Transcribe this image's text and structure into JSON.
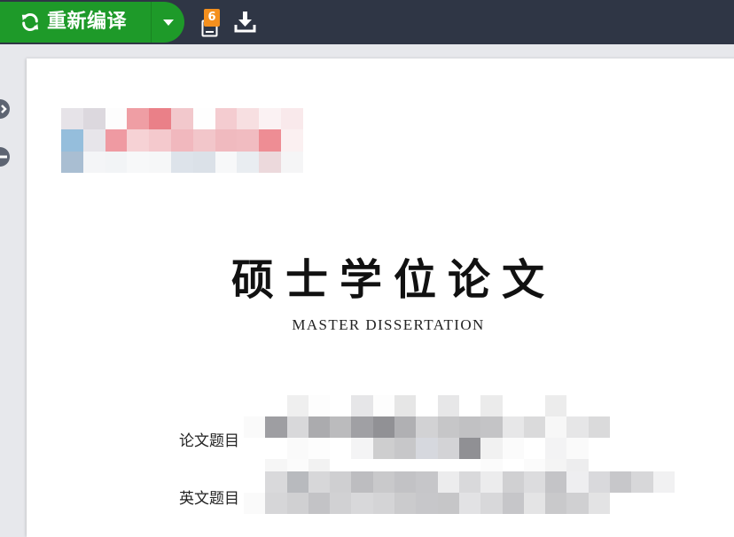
{
  "toolbar": {
    "recompile_label": "重新编译",
    "logs_badge_count": "6",
    "colors": {
      "bar": "#2f3645",
      "recompile": "#1e9a29",
      "badge": "#f5901e"
    }
  },
  "document": {
    "title_cn": "硕士学位论文",
    "title_en": "MASTER DISSERTATION",
    "fields": [
      {
        "label": "论文题目"
      },
      {
        "label": "英文题目"
      }
    ]
  }
}
